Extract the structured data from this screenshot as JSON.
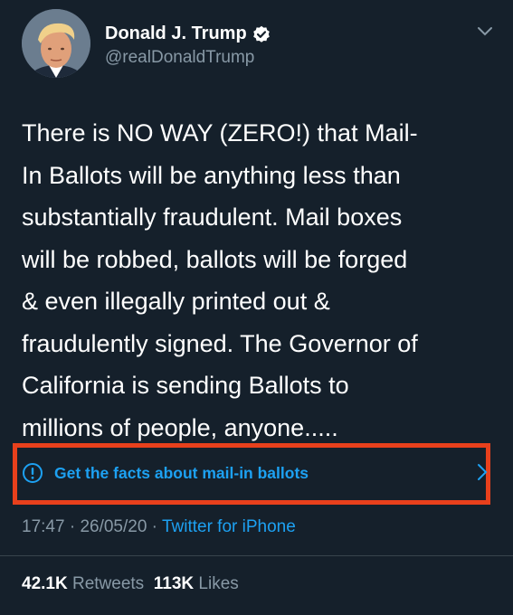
{
  "user": {
    "display_name": "Donald J. Trump",
    "handle": "@realDonaldTrump",
    "verified": true,
    "avatar": "profile-photo"
  },
  "tweet": {
    "lines": [
      "There is NO WAY (ZERO!) that Mail-",
      "In Ballots will be anything less than",
      "substantially fraudulent. Mail boxes",
      "will be robbed, ballots will be forged",
      "& even illegally printed out &",
      "fraudulently signed. The Governor of",
      "California is sending Ballots to",
      "millions of people, anyone....."
    ]
  },
  "fact_check": {
    "label": "Get the facts about mail-in ballots",
    "icon": "info-icon",
    "highlight_color": "#e8401c"
  },
  "meta": {
    "time": "17:47",
    "sep1": " · ",
    "date": "26/05/20",
    "sep2": " · ",
    "source": "Twitter for iPhone"
  },
  "stats": {
    "retweets_count": "42.1K",
    "retweets_label": "Retweets",
    "likes_count": "113K",
    "likes_label": "Likes"
  },
  "colors": {
    "background": "#15202b",
    "accent": "#1da1f2",
    "secondary_text": "#8899a6"
  }
}
